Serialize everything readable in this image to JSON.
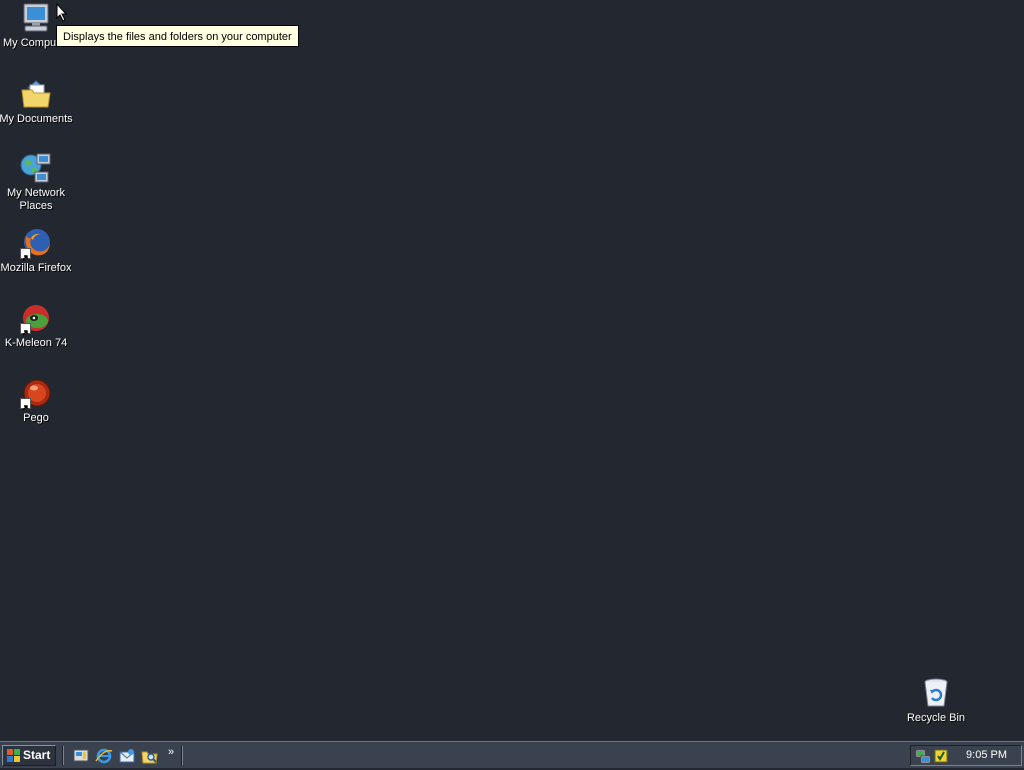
{
  "desktop": {
    "icons": [
      {
        "label": "My Computer",
        "icon": "my-computer-icon"
      },
      {
        "label": "My Documents",
        "icon": "my-documents-icon"
      },
      {
        "label": "My Network Places",
        "icon": "network-places-icon"
      },
      {
        "label": "Mozilla Firefox",
        "icon": "firefox-icon"
      },
      {
        "label": "K-Meleon 74",
        "icon": "k-meleon-icon"
      },
      {
        "label": "Pego",
        "icon": "pego-icon"
      }
    ],
    "recycle_bin": {
      "label": "Recycle Bin",
      "icon": "recycle-bin-icon"
    },
    "background_color": "#232830"
  },
  "tooltip": {
    "text": "Displays the files and folders on your computer"
  },
  "taskbar": {
    "start_label": "Start",
    "quick_launch": [
      {
        "icon": "show-desktop-icon"
      },
      {
        "icon": "internet-explorer-icon"
      },
      {
        "icon": "outlook-express-icon"
      },
      {
        "icon": "explorer-search-icon"
      }
    ],
    "overflow_label": "»",
    "tray_icons": [
      {
        "icon": "network-connection-icon"
      },
      {
        "icon": "security-shield-icon"
      }
    ],
    "clock": "9:05 PM"
  }
}
